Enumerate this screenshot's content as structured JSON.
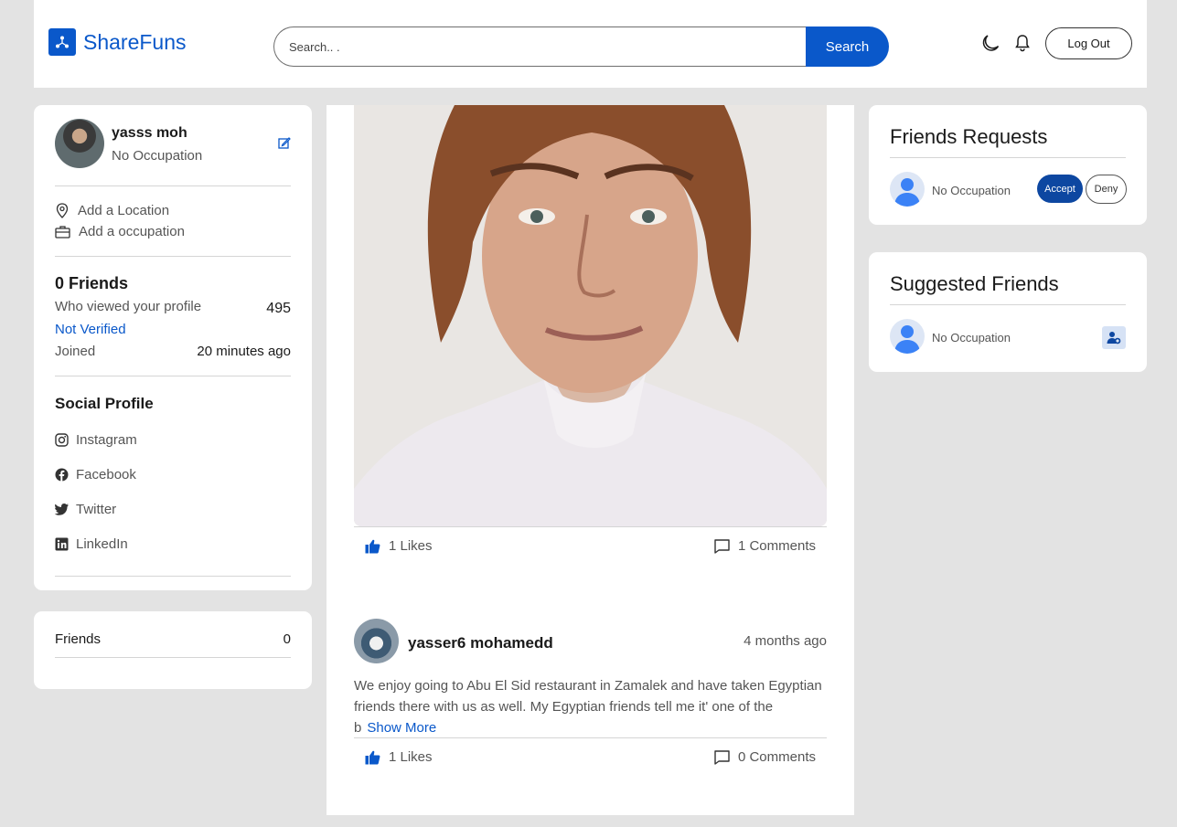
{
  "colors": {
    "accent": "#0a58ca",
    "accept": "#0d47a1",
    "page_bg": "#e3e3e3"
  },
  "header": {
    "brand": "ShareFuns",
    "search_placeholder": "Search.. .",
    "search_button": "Search",
    "logout": "Log Out",
    "icons": [
      "share-logo-icon",
      "moon-icon",
      "bell-icon"
    ]
  },
  "profile": {
    "name": "yasss moh",
    "occupation": "No Occupation",
    "add_location": "Add a Location",
    "add_occupation": "Add a occupation",
    "friends_count": "0 Friends",
    "viewed_label": "Who viewed your profile",
    "viewed_value": "495",
    "verified": "Not Verified",
    "joined_label": "Joined",
    "joined_value": "20 minutes ago",
    "social_title": "Social Profile",
    "social": [
      "Instagram",
      "Facebook",
      "Twitter",
      "LinkedIn"
    ]
  },
  "friends_box": {
    "label": "Friends",
    "count": "0"
  },
  "feed": {
    "posts": [
      {
        "likes": "1 Likes",
        "comments": "1 Comments"
      },
      {
        "author": "yasser6 mohamedd",
        "time": "4 months ago",
        "text_line1": "We enjoy going to Abu El Sid restaurant in Zamalek and have taken Egyptian",
        "text_line2": "friends there with us as well. My Egyptian friends tell me it' one of the",
        "text_line3": "b",
        "show_more": "Show More",
        "likes": "1 Likes",
        "comments": "0 Comments"
      }
    ]
  },
  "requests": {
    "title": "Friends Requests",
    "occupation": "No Occupation",
    "accept": "Accept",
    "deny": "Deny"
  },
  "suggested": {
    "title": "Suggested Friends",
    "occupation": "No Occupation"
  }
}
